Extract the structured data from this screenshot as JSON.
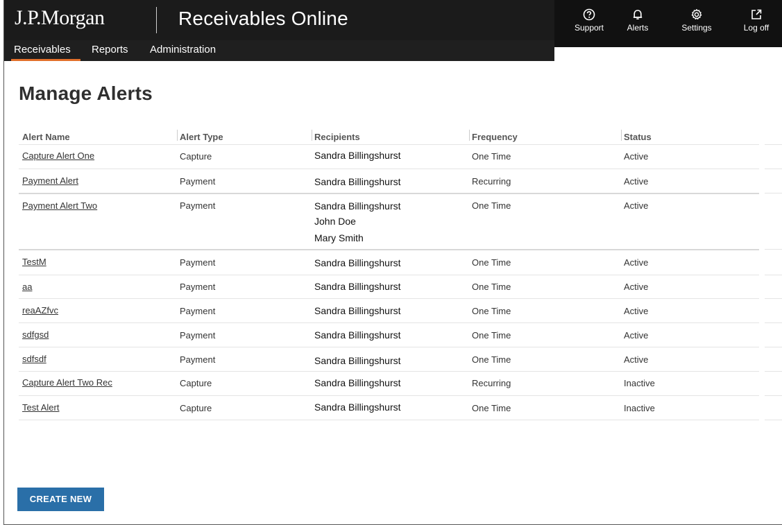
{
  "header": {
    "brand": "J.P.Morgan",
    "app_title": "Receivables Online",
    "utilities": [
      {
        "label": "Support",
        "icon": "question-circle-icon"
      },
      {
        "label": "Alerts",
        "icon": "bell-icon"
      },
      {
        "label": "Settings",
        "icon": "gear-icon"
      },
      {
        "label": "Log off",
        "icon": "external-link-icon"
      }
    ]
  },
  "nav": {
    "items": [
      {
        "label": "Receivables",
        "active": true
      },
      {
        "label": "Reports",
        "active": false
      },
      {
        "label": "Administration",
        "active": false
      }
    ]
  },
  "page": {
    "title": "Manage Alerts"
  },
  "table": {
    "columns": [
      "Alert Name",
      "Alert Type",
      "Recipients",
      "Frequency",
      "Status"
    ],
    "rows": [
      {
        "name": "Capture Alert One",
        "type": "Capture",
        "recipients": [
          "Sandra Billingshurst"
        ],
        "frequency": "One Time",
        "status": "Active"
      },
      {
        "name": "Payment Alert",
        "type": "Payment",
        "recipients": [
          "Sandra Billingshurst"
        ],
        "frequency": "Recurring",
        "status": "Active"
      },
      {
        "name": "Payment Alert Two",
        "type": "Payment",
        "recipients": [
          "Sandra Billingshurst",
          "John Doe",
          "Mary Smith"
        ],
        "frequency": "One Time",
        "status": "Active"
      },
      {
        "name": "TestM",
        "type": "Payment",
        "recipients": [
          "Sandra Billingshurst"
        ],
        "frequency": "One Time",
        "status": "Active"
      },
      {
        "name": "aa",
        "type": "Payment",
        "recipients": [
          "Sandra Billingshurst"
        ],
        "frequency": "One Time",
        "status": "Active"
      },
      {
        "name": "reaAZfvc",
        "type": "Payment",
        "recipients": [
          "Sandra Billingshurst"
        ],
        "frequency": "One Time",
        "status": "Active"
      },
      {
        "name": "sdfgsd",
        "type": "Payment",
        "recipients": [
          "Sandra Billingshurst"
        ],
        "frequency": "One Time",
        "status": "Active"
      },
      {
        "name": "sdfsdf",
        "type": "Payment",
        "recipients": [
          "Sandra Billingshurst"
        ],
        "frequency": "One Time",
        "status": "Active"
      },
      {
        "name": "Capture Alert Two Rec",
        "type": "Capture",
        "recipients": [
          "Sandra Billingshurst"
        ],
        "frequency": "Recurring",
        "status": "Inactive"
      },
      {
        "name": "Test Alert",
        "type": "Capture",
        "recipients": [
          "Sandra Billingshurst"
        ],
        "frequency": "One Time",
        "status": "Inactive"
      }
    ]
  },
  "actions": {
    "create_new_label": "CREATE NEW"
  },
  "colors": {
    "topbar": "#1b1b1b",
    "nav_active": "#e2702b",
    "primary_button": "#2a6fa8"
  }
}
